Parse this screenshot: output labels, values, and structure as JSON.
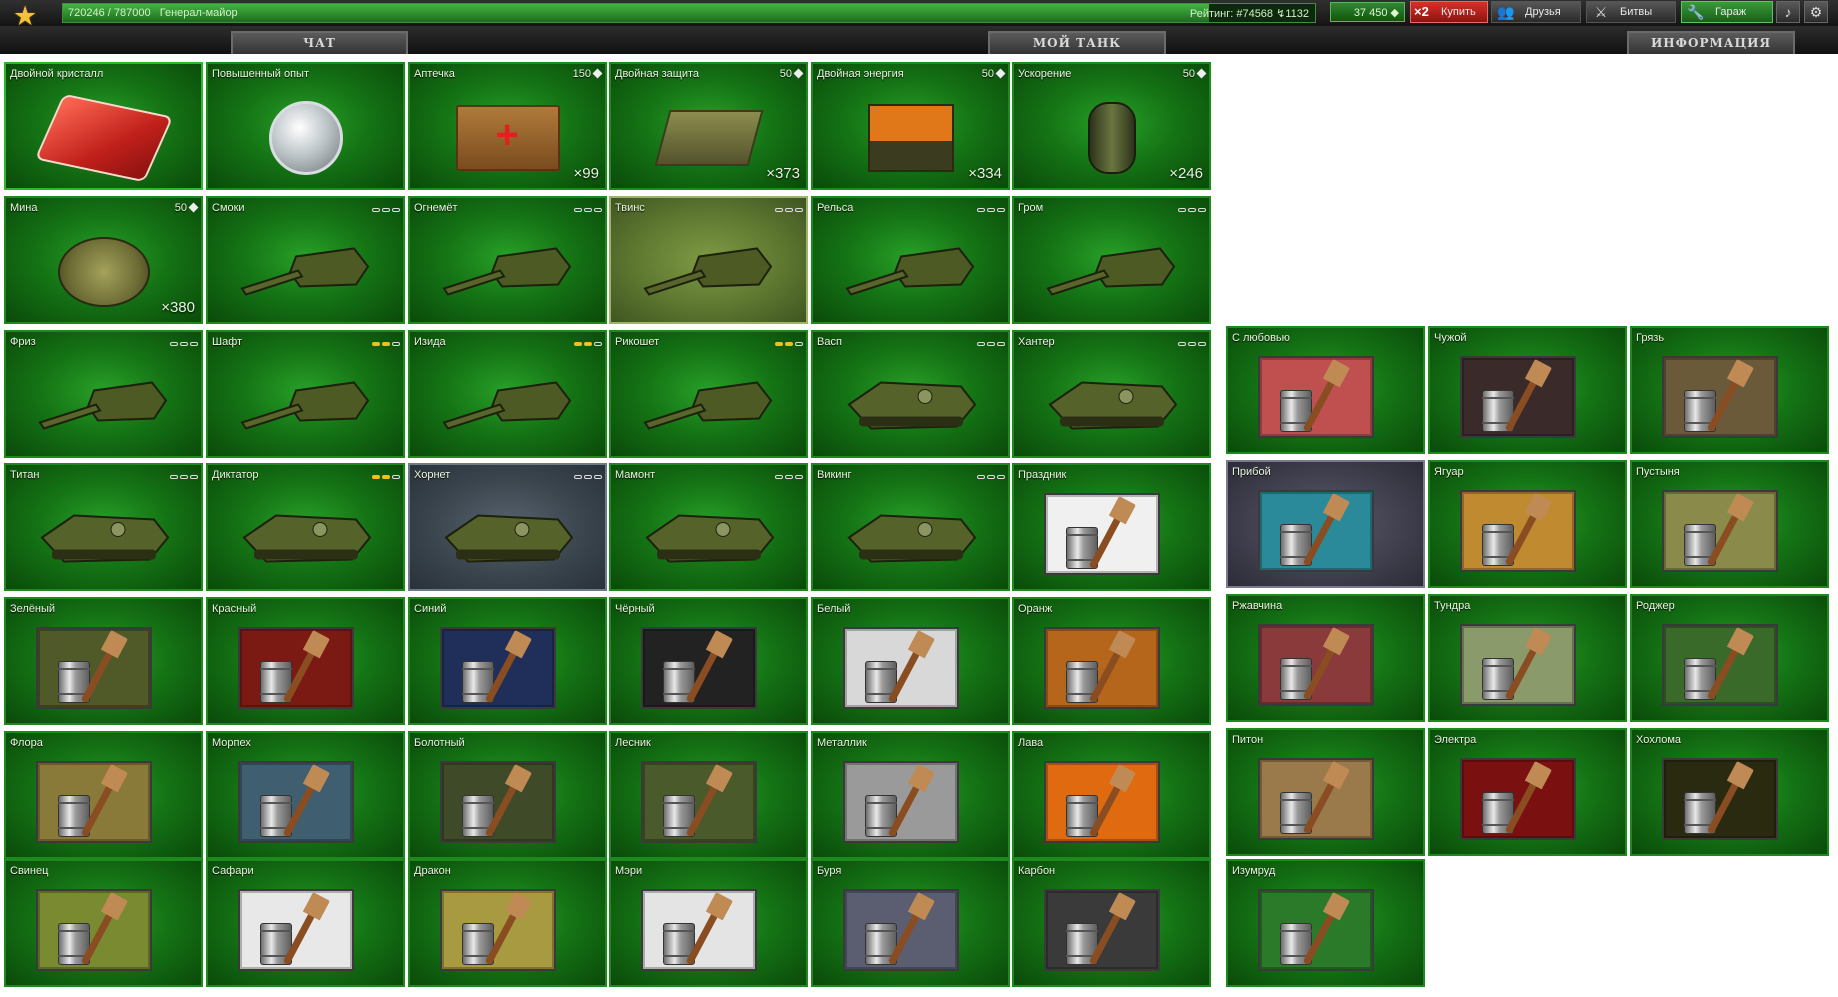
{
  "header": {
    "experience": "720246 / 787000",
    "experience_progress": 0.915,
    "rank": "Генерал-майор",
    "rating": "Рейтинг: #74568",
    "rating_change": "↯1132",
    "crystals": "37 450",
    "buy_label": "Купить",
    "buy_multiplier": "×2",
    "friends_label": "Друзья",
    "battles_label": "Битвы",
    "garage_label": "Гараж"
  },
  "tabs": {
    "chat": "ЧАТ",
    "mytank": "МОЙ ТАНК",
    "info": "ИНФОРМАЦИЯ"
  },
  "colors": {
    "accent_green": "#1d8a1d",
    "buy_red": "#c8231e",
    "mod_on": "#f0c020"
  },
  "supplies": [
    {
      "name": "Двойной кристалл",
      "price": "",
      "count": "",
      "icon": "double-crystal-card"
    },
    {
      "name": "Повышенный опыт",
      "price": "",
      "count": "",
      "icon": "experience-medal"
    },
    {
      "name": "Аптечка",
      "price": "150",
      "count": "×99",
      "icon": "medkit-box"
    },
    {
      "name": "Двойная защита",
      "price": "50",
      "count": "×373",
      "icon": "armor-plates"
    },
    {
      "name": "Двойная энергия",
      "price": "50",
      "count": "×334",
      "icon": "energy-battery"
    },
    {
      "name": "Ускорение",
      "price": "50",
      "count": "×246",
      "icon": "nitro-grenade"
    }
  ],
  "row2": [
    {
      "name": "Мина",
      "price": "50",
      "count": "×380",
      "icon": "mine",
      "mods": 0
    },
    {
      "name": "Смоки",
      "icon": "turret",
      "mods": 0
    },
    {
      "name": "Огнемёт",
      "icon": "turret",
      "mods": 0
    },
    {
      "name": "Твинс",
      "icon": "turret",
      "mods": 0
    },
    {
      "name": "Рельса",
      "icon": "turret",
      "mods": 0
    },
    {
      "name": "Гром",
      "icon": "turret",
      "mods": 0
    }
  ],
  "row3": [
    {
      "name": "Фриз",
      "icon": "turret",
      "mods": 0
    },
    {
      "name": "Шафт",
      "icon": "turret",
      "mods": 2
    },
    {
      "name": "Изида",
      "icon": "turret",
      "mods": 2
    },
    {
      "name": "Рикошет",
      "icon": "turret",
      "mods": 2
    },
    {
      "name": "Васп",
      "icon": "hull",
      "mods": 0
    },
    {
      "name": "Хантер",
      "icon": "hull",
      "mods": 0
    }
  ],
  "row4": [
    {
      "name": "Титан",
      "icon": "hull",
      "mods": 0
    },
    {
      "name": "Диктатор",
      "icon": "hull",
      "mods": 2
    },
    {
      "name": "Хорнет",
      "icon": "hull",
      "mods": 0
    },
    {
      "name": "Мамонт",
      "icon": "hull",
      "mods": 0
    },
    {
      "name": "Викинг",
      "icon": "hull",
      "mods": 0
    },
    {
      "name": "Праздник",
      "icon": "paint"
    }
  ],
  "paints_left": [
    "Зелёный",
    "Красный",
    "Синий",
    "Чёрный",
    "Белый",
    "Оранж",
    "Флора",
    "Морпех",
    "Болотный",
    "Лесник",
    "Металлик",
    "Лава",
    "Свинец",
    "Сафари",
    "Дракон",
    "Мэри",
    "Буря",
    "Карбон"
  ],
  "paints_right": [
    "С любовью",
    "Чужой",
    "Грязь",
    "Прибой",
    "Ягуар",
    "Пустыня",
    "Ржавчина",
    "Тундра",
    "Роджер",
    "Питон",
    "Электра",
    "Хохлома",
    "Изумруд"
  ],
  "paint_colors": {
    "Праздник": "#f0f0f0",
    "Зелёный": "#4f5a28",
    "Красный": "#7a1a12",
    "Синий": "#1f2f5a",
    "Чёрный": "#222222",
    "Белый": "#d8d8d8",
    "Оранж": "#b5661a",
    "Флора": "#8a7a3a",
    "Морпех": "#3f5e70",
    "Болотный": "#3f4a28",
    "Лесник": "#4a5a2a",
    "Металлик": "#9a9a9a",
    "Лава": "#e06a10",
    "Свинец": "#7a8a30",
    "Сафари": "#e8e8e8",
    "Дракон": "#a89a40",
    "Мэри": "#e4e4e4",
    "Буря": "#5a5e70",
    "Карбон": "#3a3a3a",
    "С любовью": "#c05050",
    "Чужой": "#3a2a2a",
    "Грязь": "#6a5a3a",
    "Прибой": "#2a8a9a",
    "Ягуар": "#c08a30",
    "Пустыня": "#8a8a4a",
    "Ржавчина": "#8a3a3a",
    "Тундра": "#8a9a6a",
    "Роджер": "#3a6a2a",
    "Питон": "#9a7a4a",
    "Электра": "#7a1010",
    "Хохлома": "#2a2a10",
    "Изумруд": "#2a7a2a"
  }
}
